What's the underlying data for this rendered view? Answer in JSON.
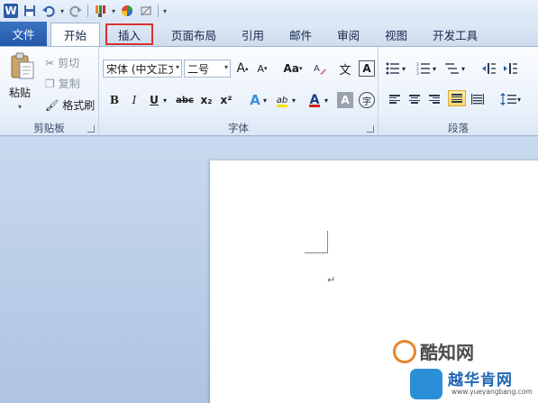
{
  "app": {
    "logo_letter": "W"
  },
  "tabs": [
    {
      "label": "文件"
    },
    {
      "label": "开始"
    },
    {
      "label": "插入"
    },
    {
      "label": "页面布局"
    },
    {
      "label": "引用"
    },
    {
      "label": "邮件"
    },
    {
      "label": "审阅"
    },
    {
      "label": "视图"
    },
    {
      "label": "开发工具"
    }
  ],
  "clipboard": {
    "paste_label": "粘贴",
    "cut_label": "剪切",
    "copy_label": "复制",
    "format_painter_label": "格式刷",
    "group_label": "剪贴板"
  },
  "font": {
    "font_name": "宋体 (中文正文)",
    "font_size": "二号",
    "group_label": "字体",
    "grow_label": "A",
    "shrink_label": "A",
    "case_label": "Aa",
    "bold_label": "B",
    "italic_label": "I",
    "underline_label": "U",
    "strike_label": "abc",
    "subscript_label": "x₂",
    "superscript_label": "x²",
    "effects_label": "A",
    "highlight_label": "ab",
    "color_label": "A",
    "shading_label": "A",
    "phonetic_label": "文",
    "enclose_label": "字",
    "highlight_color": "#f5e11a",
    "font_color": "#d11f1f"
  },
  "paragraph": {
    "group_label": "段落"
  },
  "document": {
    "paragraph_mark": "↵"
  },
  "watermarks": {
    "site1_name": "酷知网",
    "site2_name": "越华肯网",
    "site2_url": "www.yueyangbang.com"
  }
}
